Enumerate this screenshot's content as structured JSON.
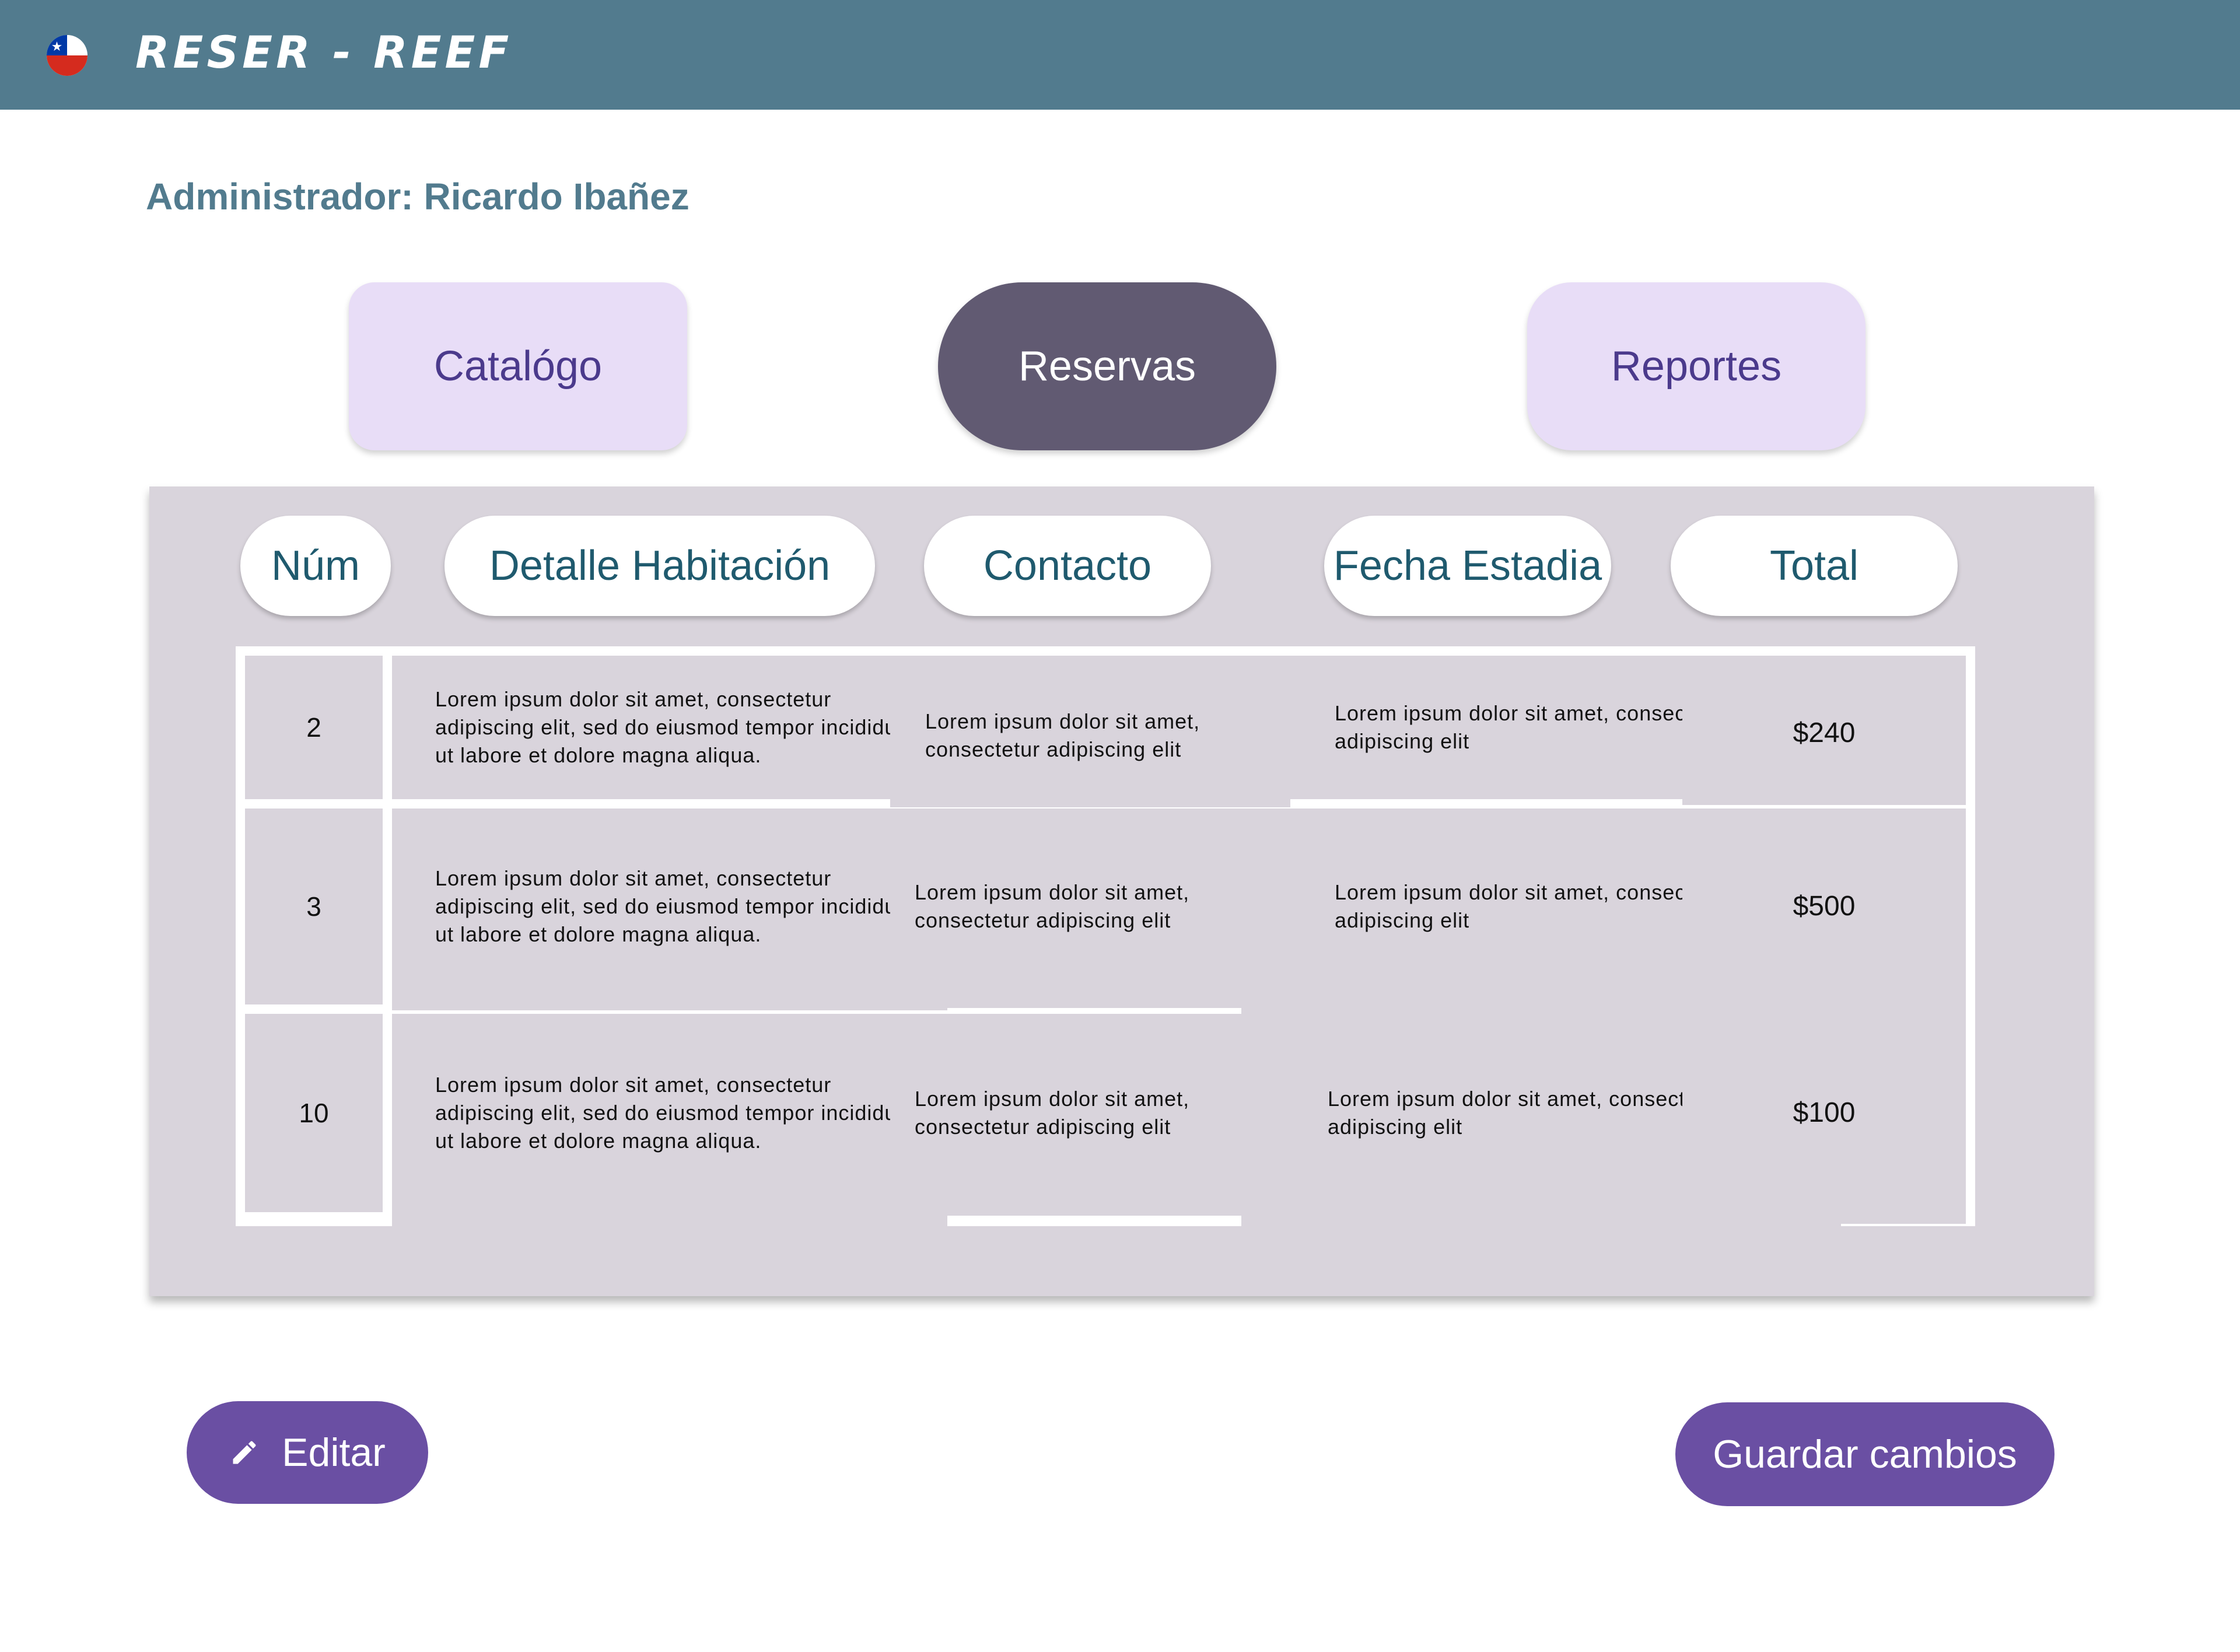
{
  "header": {
    "brand": "RESER - REEF",
    "flag_icon": "chile-flag-icon"
  },
  "admin_label": "Administrador: Ricardo Ibañez",
  "tabs": [
    {
      "label": "Catalógo",
      "active": false
    },
    {
      "label": "Reservas",
      "active": true
    },
    {
      "label": "Reportes",
      "active": false
    }
  ],
  "table": {
    "columns": [
      "Núm",
      "Detalle Habitación",
      "Contacto",
      "Fecha Estadia",
      "Total"
    ],
    "rows": [
      {
        "num": "2",
        "detalle": "Lorem ipsum dolor sit amet, consectetur adipiscing elit, sed do eiusmod tempor incididunt ut labore et dolore magna aliqua.",
        "contacto": "Lorem ipsum dolor sit amet, consectetur adipiscing elit",
        "fecha": "Lorem ipsum dolor sit amet, consectetur adipiscing elit",
        "total": "$240"
      },
      {
        "num": "3",
        "detalle": "Lorem ipsum dolor sit amet, consectetur adipiscing elit, sed do eiusmod tempor incididunt ut labore et dolore magna aliqua.",
        "contacto": "Lorem ipsum dolor sit amet, consectetur adipiscing elit",
        "fecha": "Lorem ipsum dolor sit amet, consectetur adipiscing elit",
        "total": "$500"
      },
      {
        "num": "10",
        "detalle": "Lorem ipsum dolor sit amet, consectetur adipiscing elit, sed do eiusmod tempor incididunt ut labore et dolore magna aliqua.",
        "contacto": "Lorem ipsum dolor sit amet, consectetur adipiscing elit",
        "fecha": "Lorem ipsum dolor sit amet, consectetur adipiscing elit",
        "total": "$100"
      }
    ]
  },
  "actions": {
    "edit_label": "Editar",
    "edit_icon": "pencil-icon",
    "save_label": "Guardar cambios"
  },
  "colors": {
    "header_bg": "#527b8e",
    "tab_inactive_bg": "#e8ddf7",
    "tab_active_bg": "#615a72",
    "panel_bg": "#d9d4dc",
    "button_bg": "#6a4fa3"
  }
}
